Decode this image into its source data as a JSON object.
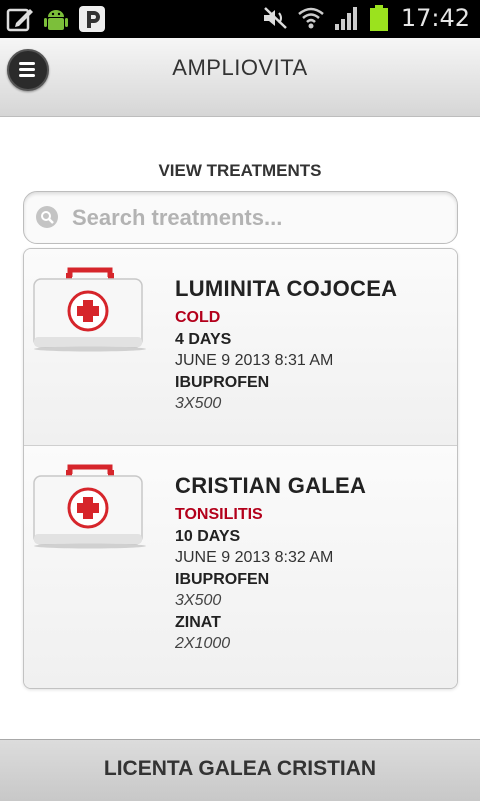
{
  "status_bar": {
    "time": "17:42",
    "icons": [
      "edit-icon",
      "android-icon",
      "p-app-icon",
      "mute-icon",
      "wifi-icon",
      "signal-icon",
      "battery-icon"
    ]
  },
  "header": {
    "title": "AMPLIOVITA",
    "menu_icon": "menu-icon"
  },
  "page": {
    "title": "VIEW TREATMENTS"
  },
  "search": {
    "placeholder": "Search treatments...",
    "value": ""
  },
  "treatments": [
    {
      "name": "LUMINITA COJOCEA",
      "diagnosis": "COLD",
      "duration": "4 DAYS",
      "date": "JUNE 9 2013 8:31 AM",
      "medications": [
        {
          "name": "IBUPROFEN",
          "dose": "3X500"
        }
      ]
    },
    {
      "name": "CRISTIAN GALEA",
      "diagnosis": "TONSILITIS",
      "duration": "10 DAYS",
      "date": "JUNE 9 2013 8:32 AM",
      "medications": [
        {
          "name": "IBUPROFEN",
          "dose": "3X500"
        },
        {
          "name": "ZINAT",
          "dose": "2X1000"
        }
      ]
    }
  ],
  "footer": {
    "text": "LICENTA GALEA CRISTIAN"
  },
  "colors": {
    "diagnosis": "#b3001b",
    "status_bar_bg": "#000000",
    "header_bg": "#e6e6e6",
    "footer_bg": "#d2d2d2"
  }
}
